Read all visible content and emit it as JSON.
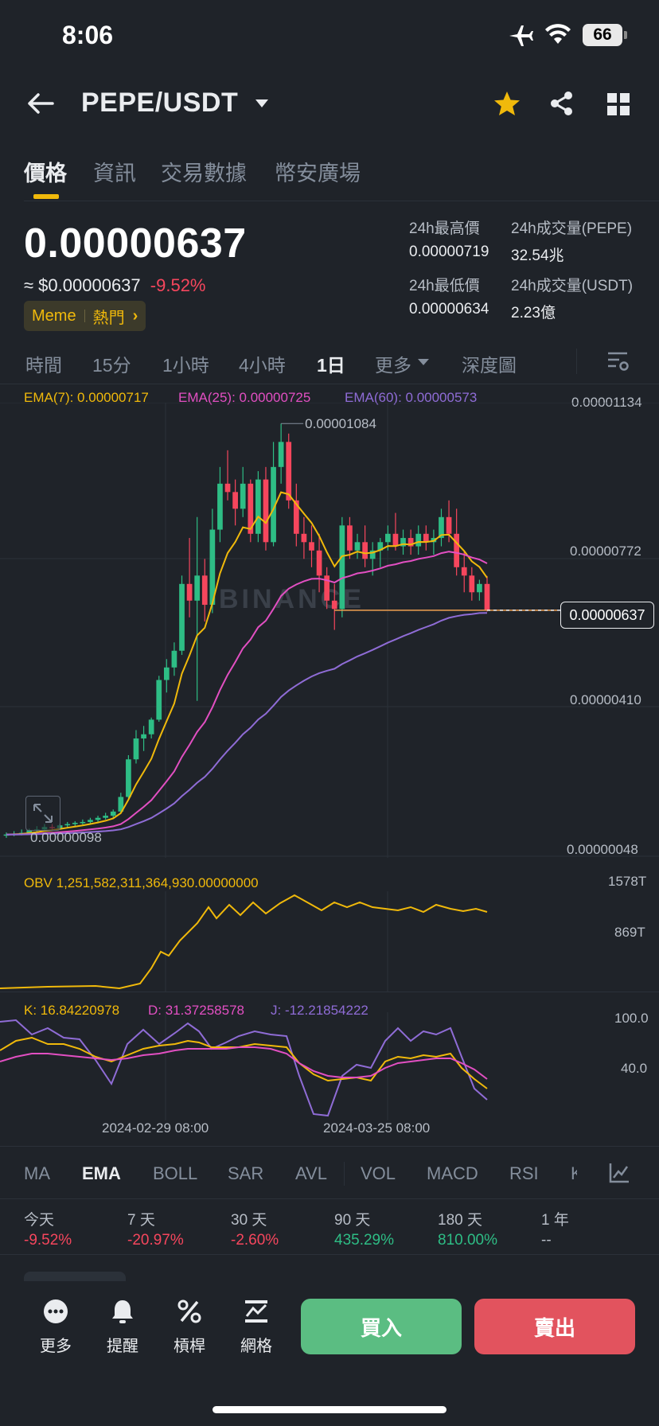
{
  "status_bar": {
    "time": "8:06",
    "battery": "66",
    "icons": [
      "airplane-icon",
      "wifi-icon",
      "battery-icon"
    ]
  },
  "header": {
    "pair": "PEPE/USDT",
    "icons": [
      "back-arrow-icon",
      "chevron-down-icon",
      "star-icon",
      "share-icon",
      "grid-icon"
    ]
  },
  "tabs": [
    {
      "label": "價格",
      "active": true
    },
    {
      "label": "資訊"
    },
    {
      "label": "交易數據"
    },
    {
      "label": "幣安廣場"
    }
  ],
  "price": {
    "last": "0.00000637",
    "usd": "≈ $0.00000637",
    "change": "-9.52%"
  },
  "tag": {
    "meme": "Meme",
    "hot": "熱門"
  },
  "stats": {
    "high_label": "24h最高價",
    "high_value": "0.00000719",
    "vol_pepe_label": "24h成交量(PEPE)",
    "vol_pepe_value": "32.54兆",
    "low_label": "24h最低價",
    "low_value": "0.00000634",
    "vol_usdt_label": "24h成交量(USDT)",
    "vol_usdt_value": "2.23億"
  },
  "intervals": [
    "時間",
    "15分",
    "1小時",
    "4小時",
    "1日",
    "更多",
    "深度圖"
  ],
  "interval_active": "1日",
  "ema": {
    "ema7": "EMA(7): 0.00000717",
    "ema25": "EMA(25): 0.00000725",
    "ema60": "EMA(60): 0.00000573"
  },
  "price_axis": [
    "0.00001134",
    "0.00000772",
    "0.00000410",
    "0.00000048"
  ],
  "current_price_tag": "0.00000637",
  "annotations": {
    "high": "0.00001084",
    "low": "0.00000098"
  },
  "obv": {
    "label": "OBV 1,251,582,311,364,930.00000000",
    "axis": [
      "1578T",
      "869T"
    ]
  },
  "kdj": {
    "k": "K: 16.84220978",
    "d": "D: 31.37258578",
    "j": "J: -12.21854222",
    "axis": [
      "100.0",
      "40.0"
    ]
  },
  "dates": [
    "2024-02-29 08:00",
    "2024-03-25 08:00"
  ],
  "watermark": "BINANCE",
  "indicators": [
    "MA",
    "EMA",
    "BOLL",
    "SAR",
    "AVL",
    "VOL",
    "MACD",
    "RSI",
    "K"
  ],
  "indicator_active": "EMA",
  "performance": [
    {
      "label": "今天",
      "value": "-9.52%",
      "dir": "down"
    },
    {
      "label": "7 天",
      "value": "-20.97%",
      "dir": "down"
    },
    {
      "label": "30 天",
      "value": "-2.60%",
      "dir": "down"
    },
    {
      "label": "90 天",
      "value": "435.29%",
      "dir": "up"
    },
    {
      "label": "180 天",
      "value": "810.00%",
      "dir": "up"
    },
    {
      "label": "1 年",
      "value": "--",
      "dir": "none"
    }
  ],
  "bottom_nav": [
    {
      "label": "更多",
      "icon": "more-dots-icon"
    },
    {
      "label": "提醒",
      "icon": "bell-icon"
    },
    {
      "label": "槓桿",
      "icon": "percent-icon"
    },
    {
      "label": "網格",
      "icon": "grid-trading-icon"
    }
  ],
  "buy_label": "買入",
  "sell_label": "賣出",
  "colors": {
    "green": "#2ebd85",
    "red": "#f6465d",
    "yellow": "#f0b90b",
    "ema25": "#e24fc2",
    "ema60": "#8f6cd6",
    "bg": "#1f2329"
  },
  "chart_data": {
    "type": "candlestick",
    "ylim": [
      4.8e-07,
      1.134e-05
    ],
    "candles": [
      {
        "o": 9.8e-07,
        "h": 1.05e-06,
        "l": 9.2e-07,
        "c": 1e-06
      },
      {
        "o": 1e-06,
        "h": 1.08e-06,
        "l": 9.6e-07,
        "c": 1.02e-06
      },
      {
        "o": 1.02e-06,
        "h": 1.12e-06,
        "l": 9.8e-07,
        "c": 1.04e-06
      },
      {
        "o": 1.04e-06,
        "h": 1.14e-06,
        "l": 1e-06,
        "c": 1.1e-06
      },
      {
        "o": 1.1e-06,
        "h": 1.2e-06,
        "l": 1.05e-06,
        "c": 1.12e-06
      },
      {
        "o": 1.12e-06,
        "h": 1.25e-06,
        "l": 1.08e-06,
        "c": 1.18e-06
      },
      {
        "o": 1.18e-06,
        "h": 1.25e-06,
        "l": 1.1e-06,
        "c": 1.15e-06
      },
      {
        "o": 1.15e-06,
        "h": 1.26e-06,
        "l": 1.12e-06,
        "c": 1.22e-06
      },
      {
        "o": 1.22e-06,
        "h": 1.3e-06,
        "l": 1.16e-06,
        "c": 1.25e-06
      },
      {
        "o": 1.25e-06,
        "h": 1.32e-06,
        "l": 1.18e-06,
        "c": 1.28e-06
      },
      {
        "o": 1.28e-06,
        "h": 1.36e-06,
        "l": 1.24e-06,
        "c": 1.3e-06
      },
      {
        "o": 1.3e-06,
        "h": 1.4e-06,
        "l": 1.26e-06,
        "c": 1.35e-06
      },
      {
        "o": 1.35e-06,
        "h": 1.45e-06,
        "l": 1.3e-06,
        "c": 1.4e-06
      },
      {
        "o": 1.4e-06,
        "h": 1.52e-06,
        "l": 1.36e-06,
        "c": 1.45e-06
      },
      {
        "o": 1.45e-06,
        "h": 1.6e-06,
        "l": 1.4e-06,
        "c": 1.55e-06
      },
      {
        "o": 1.55e-06,
        "h": 2e-06,
        "l": 1.5e-06,
        "c": 1.9e-06
      },
      {
        "o": 1.9e-06,
        "h": 2.9e-06,
        "l": 1.85e-06,
        "c": 2.8e-06
      },
      {
        "o": 2.8e-06,
        "h": 3.5e-06,
        "l": 2.7e-06,
        "c": 3.3e-06
      },
      {
        "o": 3.3e-06,
        "h": 3.6e-06,
        "l": 3e-06,
        "c": 3.4e-06
      },
      {
        "o": 3.4e-06,
        "h": 3.8e-06,
        "l": 3.3e-06,
        "c": 3.75e-06
      },
      {
        "o": 3.75e-06,
        "h": 4.8e-06,
        "l": 3.7e-06,
        "c": 4.7e-06
      },
      {
        "o": 4.7e-06,
        "h": 5.2e-06,
        "l": 4.4e-06,
        "c": 5e-06
      },
      {
        "o": 5e-06,
        "h": 5.6e-06,
        "l": 4.8e-06,
        "c": 5.4e-06
      },
      {
        "o": 5.4e-06,
        "h": 7.2e-06,
        "l": 5.3e-06,
        "c": 7e-06
      },
      {
        "o": 7e-06,
        "h": 8.1e-06,
        "l": 6.2e-06,
        "c": 6.6e-06
      },
      {
        "o": 6.6e-06,
        "h": 8.6e-06,
        "l": 4.2e-06,
        "c": 7.2e-06
      },
      {
        "o": 7.2e-06,
        "h": 7.6e-06,
        "l": 6.1e-06,
        "c": 6.5e-06
      },
      {
        "o": 6.5e-06,
        "h": 8.8e-06,
        "l": 6.3e-06,
        "c": 8.3e-06
      },
      {
        "o": 8.3e-06,
        "h": 9.8e-06,
        "l": 8e-06,
        "c": 9.4e-06
      },
      {
        "o": 9.4e-06,
        "h": 1.02e-05,
        "l": 9e-06,
        "c": 9.2e-06
      },
      {
        "o": 9.2e-06,
        "h": 9.5e-06,
        "l": 8.4e-06,
        "c": 8.8e-06
      },
      {
        "o": 8.8e-06,
        "h": 9.8e-06,
        "l": 8.6e-06,
        "c": 9.4e-06
      },
      {
        "o": 9.4e-06,
        "h": 9.5e-06,
        "l": 8e-06,
        "c": 8.2e-06
      },
      {
        "o": 8.2e-06,
        "h": 9.7e-06,
        "l": 8e-06,
        "c": 9.5e-06
      },
      {
        "o": 9.5e-06,
        "h": 9.8e-06,
        "l": 7.8e-06,
        "c": 8e-06
      },
      {
        "o": 8e-06,
        "h": 1.04e-05,
        "l": 7.9e-06,
        "c": 9.8e-06
      },
      {
        "o": 9.8e-06,
        "h": 1.084e-05,
        "l": 9.4e-06,
        "c": 1.04e-05
      },
      {
        "o": 1.04e-05,
        "h": 1.06e-05,
        "l": 8.8e-06,
        "c": 9e-06
      },
      {
        "o": 9e-06,
        "h": 9.4e-06,
        "l": 7.9e-06,
        "c": 8.2e-06
      },
      {
        "o": 8.2e-06,
        "h": 8.6e-06,
        "l": 7.6e-06,
        "c": 8e-06
      },
      {
        "o": 8e-06,
        "h": 8.4e-06,
        "l": 7.4e-06,
        "c": 7.8e-06
      },
      {
        "o": 7.8e-06,
        "h": 8.2e-06,
        "l": 6.8e-06,
        "c": 7.2e-06
      },
      {
        "o": 7.2e-06,
        "h": 7.4e-06,
        "l": 6.4e-06,
        "c": 6.6e-06
      },
      {
        "o": 6.6e-06,
        "h": 7e-06,
        "l": 5.9e-06,
        "c": 6.4e-06
      },
      {
        "o": 6.4e-06,
        "h": 8.6e-06,
        "l": 6.2e-06,
        "c": 8.4e-06
      },
      {
        "o": 8.4e-06,
        "h": 8.6e-06,
        "l": 7.6e-06,
        "c": 7.8e-06
      },
      {
        "o": 7.8e-06,
        "h": 8.2e-06,
        "l": 7.6e-06,
        "c": 8e-06
      },
      {
        "o": 8e-06,
        "h": 8.4e-06,
        "l": 7.4e-06,
        "c": 7.6e-06
      },
      {
        "o": 7.6e-06,
        "h": 8e-06,
        "l": 7.2e-06,
        "c": 7.8e-06
      },
      {
        "o": 7.8e-06,
        "h": 8.1e-06,
        "l": 7.4e-06,
        "c": 8e-06
      },
      {
        "o": 8e-06,
        "h": 8.4e-06,
        "l": 7.8e-06,
        "c": 8.2e-06
      },
      {
        "o": 8.2e-06,
        "h": 8.7e-06,
        "l": 7.8e-06,
        "c": 7.9e-06
      },
      {
        "o": 7.9e-06,
        "h": 8.3e-06,
        "l": 7.7e-06,
        "c": 8.1e-06
      },
      {
        "o": 8.1e-06,
        "h": 8.3e-06,
        "l": 7.7e-06,
        "c": 7.9e-06
      },
      {
        "o": 7.9e-06,
        "h": 8.4e-06,
        "l": 7.7e-06,
        "c": 8.2e-06
      },
      {
        "o": 8.2e-06,
        "h": 8.4e-06,
        "l": 7.8e-06,
        "c": 8e-06
      },
      {
        "o": 8e-06,
        "h": 8.3e-06,
        "l": 7.7e-06,
        "c": 8.1e-06
      },
      {
        "o": 8.1e-06,
        "h": 8.8e-06,
        "l": 7.9e-06,
        "c": 8.6e-06
      },
      {
        "o": 8.6e-06,
        "h": 9e-06,
        "l": 8e-06,
        "c": 8.2e-06
      },
      {
        "o": 8.2e-06,
        "h": 8.8e-06,
        "l": 7.2e-06,
        "c": 7.4e-06
      },
      {
        "o": 7.4e-06,
        "h": 7.8e-06,
        "l": 6.8e-06,
        "c": 7.2e-06
      },
      {
        "o": 7.2e-06,
        "h": 7.4e-06,
        "l": 6.6e-06,
        "c": 6.8e-06
      },
      {
        "o": 6.8e-06,
        "h": 7.1e-06,
        "l": 6.6e-06,
        "c": 7e-06
      },
      {
        "o": 7e-06,
        "h": 7.19e-06,
        "l": 6.34e-06,
        "c": 6.37e-06
      }
    ]
  }
}
